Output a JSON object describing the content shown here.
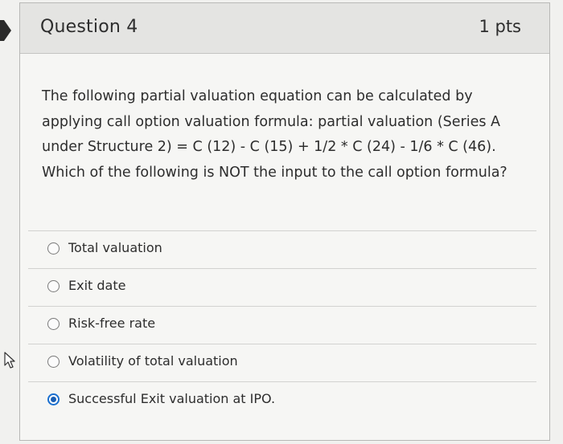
{
  "question": {
    "title": "Question 4",
    "points": "1 pts",
    "text": "The following partial valuation equation can be calculated by applying call option valuation formula: partial valuation (Series A under Structure 2) = C (12) - C (15) + 1/2 * C (24) - 1/6 * C (46). Which of the following is NOT the input to the call option formula?"
  },
  "answers": [
    {
      "label": "Total valuation",
      "selected": false
    },
    {
      "label": "Exit date",
      "selected": false
    },
    {
      "label": "Risk-free rate",
      "selected": false
    },
    {
      "label": "Volatility of total valuation",
      "selected": false
    },
    {
      "label": "Successful Exit valuation at IPO.",
      "selected": true
    }
  ],
  "colors": {
    "selected_radio": "#1a5fb4",
    "header_background": "#e4e4e2",
    "text": "#2d2d2d"
  },
  "icons": {
    "question_marker": "question-marker-icon",
    "cursor": "cursor-arrow-icon"
  }
}
